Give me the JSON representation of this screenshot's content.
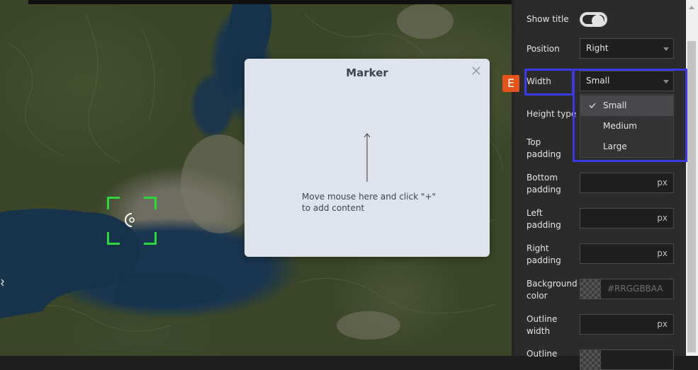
{
  "map": {
    "focus_icon": "target-icon"
  },
  "dialog": {
    "title": "Marker",
    "close_icon": "close-icon",
    "hint": "Move mouse here and click \"+\" to add content"
  },
  "panel": {
    "show_title": {
      "label": "Show title",
      "value": true
    },
    "position": {
      "label": "Position",
      "value": "Right"
    },
    "width": {
      "label": "Width",
      "value": "Small",
      "options": [
        "Small",
        "Medium",
        "Large"
      ],
      "selected_index": 0
    },
    "height_type": {
      "label": "Height type"
    },
    "top_padding": {
      "label": "Top padding",
      "unit": ""
    },
    "bottom_padding": {
      "label": "Bottom padding",
      "unit": "px"
    },
    "left_padding": {
      "label": "Left padding",
      "unit": "px"
    },
    "right_padding": {
      "label": "Right padding",
      "unit": "px"
    },
    "background_color": {
      "label": "Background color",
      "placeholder": "#RRGGBBAA"
    },
    "outline_width": {
      "label": "Outline width",
      "unit": "px"
    },
    "outline_color": {
      "label": "Outline"
    }
  },
  "annotation": {
    "badge": "E",
    "color": "#3a3ae0",
    "badge_color": "#e5531a"
  }
}
